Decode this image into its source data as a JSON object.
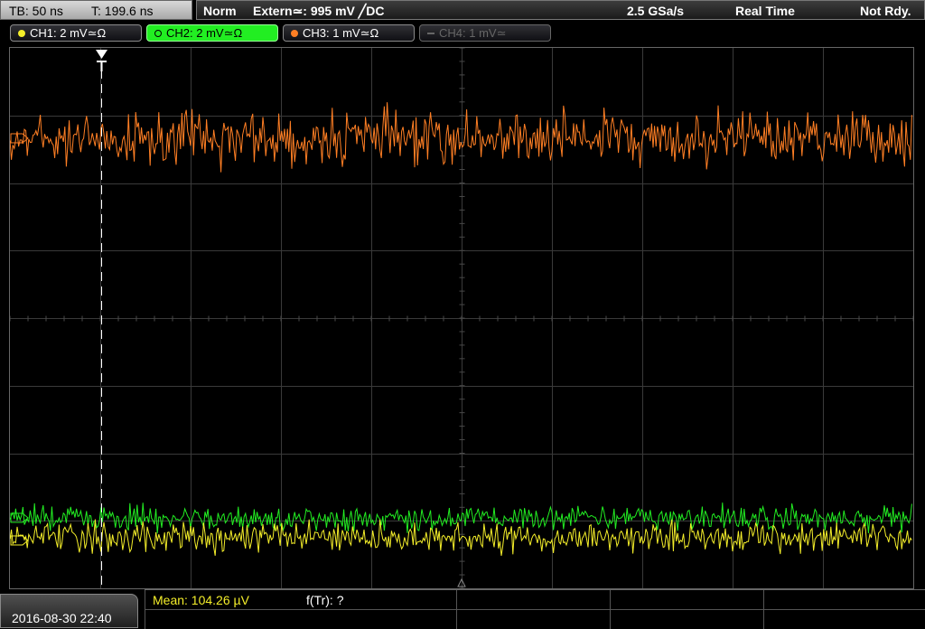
{
  "timebase": {
    "tb": "TB: 50 ns",
    "trigger_time": "T: 199.6 ns"
  },
  "status": {
    "mode": "Norm",
    "trigger_source": "Extern≃: 995 mV ╱DC",
    "sample_rate": "2.5 GSa/s",
    "acquisition": "Real Time",
    "state": "Not Rdy."
  },
  "channels": [
    {
      "label": "CH1: 2 mV≃Ω",
      "color": "#f4ee2a",
      "active": false,
      "enabled": true
    },
    {
      "label": "CH2: 2 mV≃Ω",
      "color": "#22ee22",
      "active": true,
      "enabled": true
    },
    {
      "label": "CH3: 1 mV≃Ω",
      "color": "#ff7f24",
      "active": false,
      "enabled": true
    },
    {
      "label": "CH4: 1 mV≃",
      "color": "#888888",
      "active": false,
      "enabled": false
    }
  ],
  "waveform_colors": {
    "ch3": "#ff7f24",
    "ch2": "#22ee22",
    "ch1": "#f4ee2a"
  },
  "datetime": "2016-08-30 22:40",
  "measurements": {
    "mean": "Mean: 104.26 µV",
    "ftr": "f(Tr): ?"
  }
}
